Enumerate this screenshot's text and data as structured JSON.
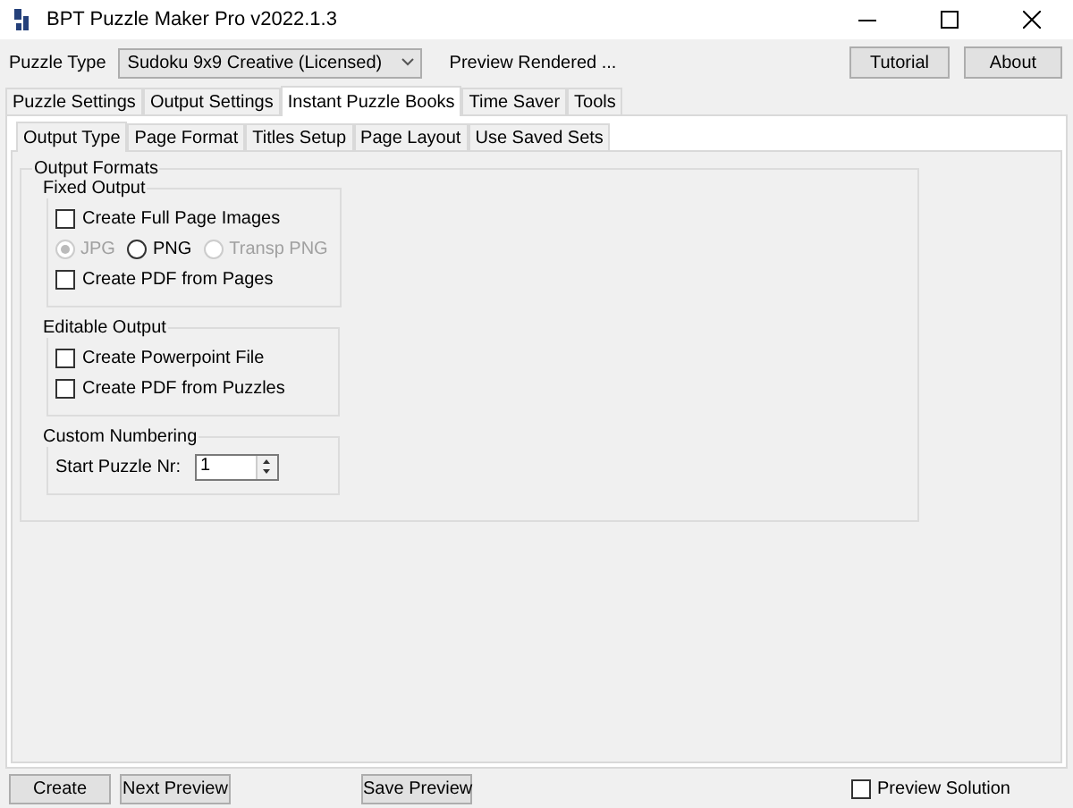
{
  "window": {
    "title": "BPT Puzzle Maker Pro v2022.1.3"
  },
  "toolbar": {
    "puzzle_type_label": "Puzzle Type",
    "puzzle_type_value": "Sudoku 9x9 Creative (Licensed)",
    "status": "Preview Rendered ...",
    "buttons": [
      "Tutorial",
      "About"
    ]
  },
  "main_tabs": [
    {
      "label": "Puzzle Settings",
      "selected": false
    },
    {
      "label": "Output Settings",
      "selected": false
    },
    {
      "label": "Instant Puzzle Books",
      "selected": true
    },
    {
      "label": "Time Saver",
      "selected": false
    },
    {
      "label": "Tools",
      "selected": false
    }
  ],
  "sub_tabs": [
    {
      "label": "Output Type",
      "selected": true
    },
    {
      "label": "Page Format",
      "selected": false
    },
    {
      "label": "Titles Setup",
      "selected": false
    },
    {
      "label": "Page Layout",
      "selected": false
    },
    {
      "label": "Use Saved Sets",
      "selected": false
    }
  ],
  "output_formats": {
    "title": "Output Formats",
    "groups": [
      {
        "title": "Fixed Output",
        "items": [
          {
            "kind": "checkbox",
            "label": "Create Full Page Images",
            "checked": false
          },
          {
            "kind": "radios",
            "options": [
              {
                "label": "JPG",
                "selected": true,
                "disabled": true
              },
              {
                "label": "PNG",
                "selected": false,
                "disabled": false
              },
              {
                "label": "Transp PNG",
                "selected": false,
                "disabled": true
              }
            ]
          },
          {
            "kind": "checkbox",
            "label": "Create PDF from Pages",
            "checked": false
          }
        ]
      },
      {
        "title": "Editable Output",
        "items": [
          {
            "kind": "checkbox",
            "label": "Create Powerpoint File",
            "checked": false
          },
          {
            "kind": "checkbox",
            "label": "Create PDF from Puzzles",
            "checked": false
          }
        ]
      },
      {
        "title": "Custom Numbering",
        "items": [
          {
            "kind": "spinner",
            "label": "Start Puzzle Nr:",
            "value": "1"
          }
        ]
      }
    ]
  },
  "bottom": {
    "buttons": [
      "Create",
      "Next Preview",
      "Save Preview"
    ],
    "preview_solution": {
      "label": "Preview Solution",
      "checked": false
    }
  }
}
